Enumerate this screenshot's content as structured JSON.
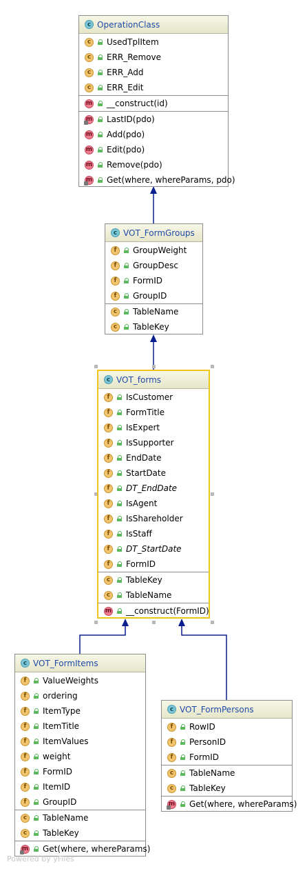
{
  "classes": {
    "operation": {
      "name": "OperationClass",
      "constants": [
        "UsedTplItem",
        "ERR_Remove",
        "ERR_Add",
        "ERR_Edit"
      ],
      "constructor": "__construct(id)",
      "methods": [
        "LastID(pdo)",
        "Add(pdo)",
        "Edit(pdo)",
        "Remove(pdo)",
        "Get(where, whereParams, pdo)"
      ]
    },
    "formgroups": {
      "name": "VOT_FormGroups",
      "fields": [
        "GroupWeight",
        "GroupDesc",
        "FormID",
        "GroupID"
      ],
      "constants": [
        "TableName",
        "TableKey"
      ]
    },
    "forms": {
      "name": "VOT_forms",
      "fields": [
        "IsCustomer",
        "FormTitle",
        "IsExpert",
        "IsSupporter",
        "EndDate",
        "StartDate",
        "DT_EndDate",
        "IsAgent",
        "IsShareholder",
        "IsStaff",
        "DT_StartDate",
        "FormID"
      ],
      "constants": [
        "TableKey",
        "TableName"
      ],
      "constructor": "__construct(FormID)"
    },
    "formitems": {
      "name": "VOT_FormItems",
      "fields": [
        "ValueWeights",
        "ordering",
        "ItemType",
        "ItemTitle",
        "ItemValues",
        "weight",
        "FormID",
        "ItemID",
        "GroupID"
      ],
      "constants": [
        "TableName",
        "TableKey"
      ],
      "methods": [
        "Get(where, whereParams)"
      ]
    },
    "formpersons": {
      "name": "VOT_FormPersons",
      "fields": [
        "RowID",
        "PersonID",
        "FormID"
      ],
      "constants": [
        "TableName",
        "TableKey"
      ],
      "methods": [
        "Get(where, whereParams)"
      ]
    }
  },
  "icons": {
    "class": "c",
    "field": "f",
    "constant": "c",
    "method": "m"
  },
  "watermark": "Powered by yFiles",
  "colors": {
    "arrow": "#0a1f8f",
    "selection": "#f0c419",
    "class_name": "#1f4aa8"
  }
}
